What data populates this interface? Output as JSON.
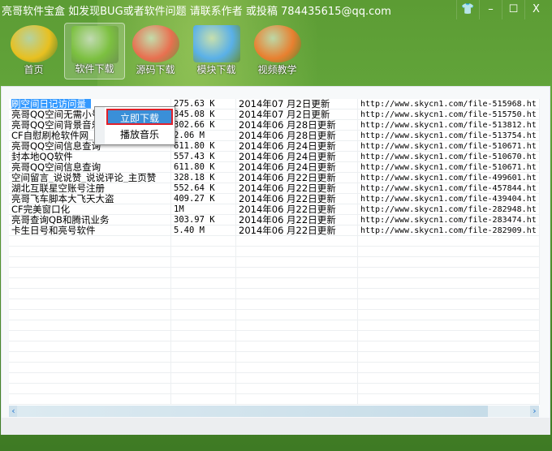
{
  "window": {
    "title": "亮哥软件宝盒  如发现BUG或者软件问题 请联系作者 或投稿 784435615@qq.com",
    "controls": [
      "skin",
      "minimize",
      "maximize",
      "close"
    ]
  },
  "nav": [
    {
      "label": "首页",
      "icon": "home-plus-icon",
      "color": "#e8c020"
    },
    {
      "label": "软件下载",
      "icon": "radar-icon",
      "color": "#7cc040",
      "active": true
    },
    {
      "label": "源码下载",
      "icon": "windows-refresh-icon",
      "color": "#e87050"
    },
    {
      "label": "模块下载",
      "icon": "monitor-stethoscope-icon",
      "color": "#5ab0e8"
    },
    {
      "label": "视频教学",
      "icon": "windows-orange-icon",
      "color": "#e88030"
    }
  ],
  "rows": [
    [
      "刷空间日记访问量_",
      "275.63 K",
      "2014年07 月2日更新",
      "http://www.skycn1.com/file-515968.ht"
    ],
    [
      "亮哥QQ空间无需小号",
      "345.08 K",
      "2014年07 月2日更新",
      "http://www.skycn1.com/file-515750.ht"
    ],
    [
      "亮哥QQ空间背景音乐",
      "302.66 K",
      "2014年06 月28日更新",
      "http://www.skycn1.com/file-513812.ht"
    ],
    [
      "CF自慰刷枪软件网_",
      "2.06 M",
      "2014年06 月28日更新",
      "http://www.skycn1.com/file-513754.ht"
    ],
    [
      "亮哥QQ空间信息查询",
      "611.80 K",
      "2014年06 月24日更新",
      "http://www.skycn1.com/file-510671.ht"
    ],
    [
      "封本地QQ软件",
      "557.43 K",
      "2014年06 月24日更新",
      "http://www.skycn1.com/file-510670.ht"
    ],
    [
      "亮哥QQ空间信息查询",
      "611.80 K",
      "2014年06 月24日更新",
      "http://www.skycn1.com/file-510671.ht"
    ],
    [
      "空间留言_说说赞_说说评论_主页赞",
      "328.18 K",
      "2014年06 月22日更新",
      "http://www.skycn1.com/file-499601.ht"
    ],
    [
      "湖北互联星空账号注册",
      "552.64 K",
      "2014年06 月22日更新",
      "http://www.skycn1.com/file-457844.ht"
    ],
    [
      "亮哥飞车脚本大飞天大盗",
      "409.27 K",
      "2014年06 月22日更新",
      "http://www.skycn1.com/file-439404.ht"
    ],
    [
      "CF完美窗口化",
      "1M",
      "2014年06 月22日更新",
      "http://www.skycn1.com/file-282948.ht"
    ],
    [
      "亮哥查询QB和腾讯业务",
      "303.97 K",
      "2014年06 月22日更新",
      "http://www.skycn1.com/file-283474.ht"
    ],
    [
      "卡生日号和亮号软件",
      "5.40 M",
      "2014年06 月22日更新",
      "http://www.skycn1.com/file-282909.ht"
    ]
  ],
  "context_menu": {
    "items": [
      "立即下载",
      "播放音乐"
    ]
  },
  "scroll": {
    "left": "‹",
    "right": "›"
  }
}
